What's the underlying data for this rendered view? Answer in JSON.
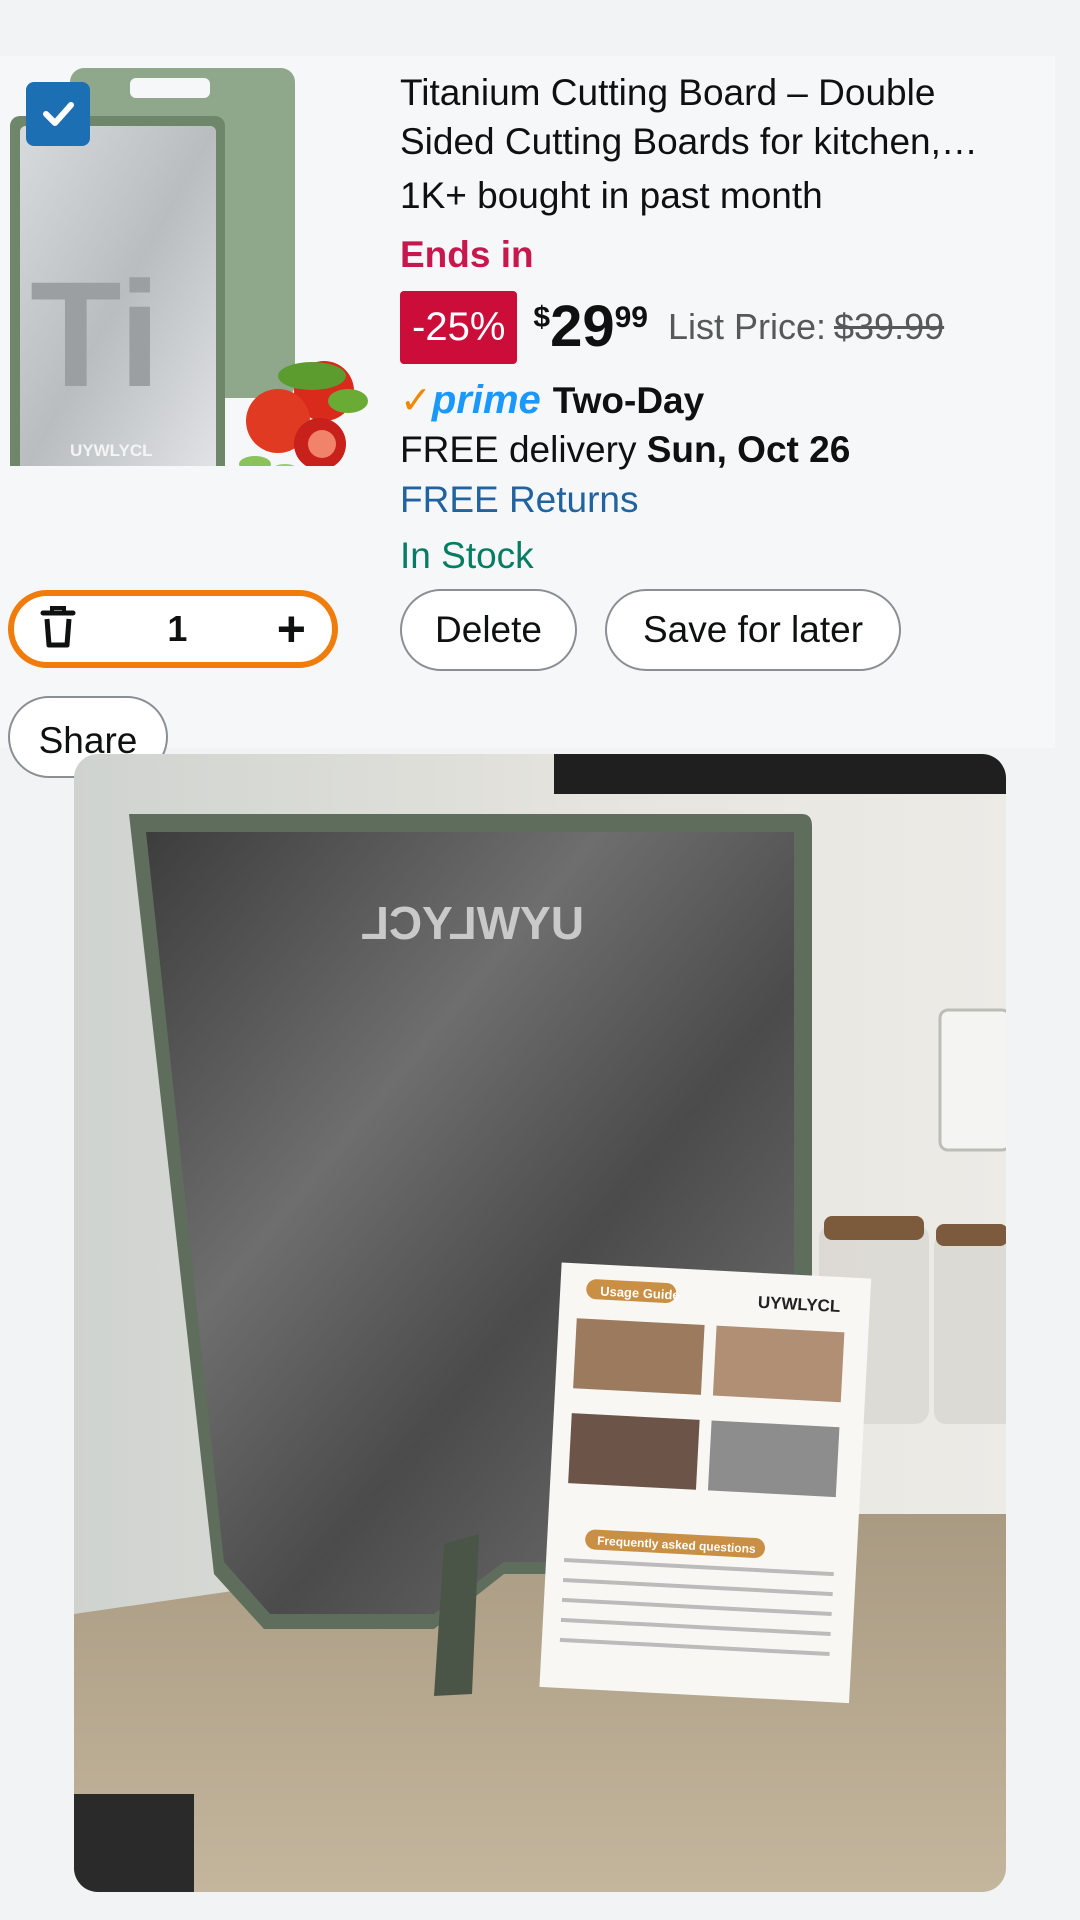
{
  "product": {
    "title": "Titanium Cutting Board – Double Sided Cutting Boards for kitchen,…",
    "bought": "1K+ bought in past month",
    "deal_label": "Ends in",
    "discount": "-25%",
    "price_currency": "$",
    "price_whole": "29",
    "price_cents": "99",
    "list_price_label": "List Price:",
    "list_price": "$39.99",
    "prime_label": "prime",
    "prime_speed": "Two-Day",
    "delivery_prefix": "FREE delivery",
    "delivery_date": "Sun, Oct 26",
    "returns": "FREE Returns",
    "stock": "In Stock",
    "thumb_brand": "UYWLYCL",
    "thumb_symbol": "Ti"
  },
  "actions": {
    "quantity": "1",
    "delete_label": "Delete",
    "save_label": "Save for later",
    "share_label": "Share"
  },
  "photo": {
    "board_brand": "UYWLYCL",
    "leaflet_brand": "UYWLYCL",
    "leaflet_guide": "Usage Guide",
    "leaflet_faq": "Frequently asked questions"
  },
  "colors": {
    "discount_bg": "#cc0c39",
    "deal_text": "#c7184e",
    "stepper_border": "#f07d0b",
    "prime_blue": "#1a98ff",
    "link_blue": "#2162a1",
    "stock_green": "#067d62",
    "checkbox_blue": "#1d6fb4"
  },
  "icons": [
    "checkmark-icon",
    "trash-icon",
    "plus-icon",
    "prime-check-icon"
  ]
}
